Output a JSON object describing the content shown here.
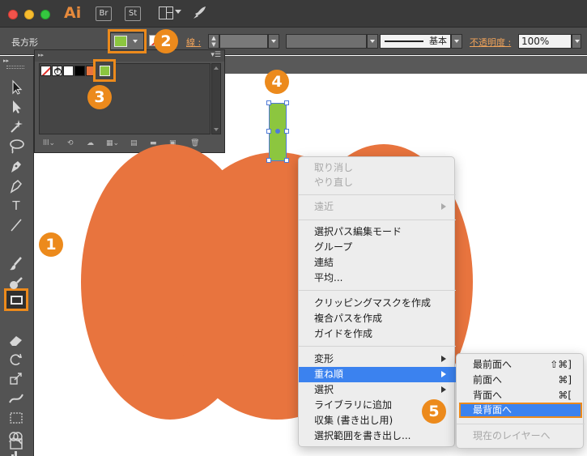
{
  "app": {
    "logo": "Ai",
    "bridge": "Br",
    "stock": "St"
  },
  "titlebar_icons": [
    "workspace-layout-icon",
    "rocket-icon"
  ],
  "control_bar": {
    "object_label": "長方形",
    "stroke_label": "線 :",
    "profile_label": "基本",
    "opacity_label": "不透明度 :",
    "opacity_value": "100%"
  },
  "colors": {
    "fill_green": "#8cc63f",
    "pumpkin_orange": "#e8743e",
    "highlight_orange": "#ec8a1c",
    "menu_highlight_blue": "#3b82ef"
  },
  "tools": [
    "selection-tool",
    "direct-selection-tool",
    "magic-wand-tool",
    "lasso-tool",
    "pen-tool",
    "curvature-tool",
    "type-tool",
    "line-segment-tool",
    "rectangle-tool",
    "paintbrush-tool",
    "blob-brush-tool",
    "eraser-tool",
    "rotate-tool",
    "scale-tool",
    "width-tool",
    "free-transform-tool",
    "shape-builder-tool",
    "graph-tool",
    "artboard-tool"
  ],
  "markers": [
    "1",
    "2",
    "3",
    "4",
    "5"
  ],
  "context_menu": {
    "undo": "取り消し",
    "redo": "やり直し",
    "recent": "遠近",
    "isolate": "選択パス編集モード",
    "group": "グループ",
    "join": "連結",
    "average": "平均...",
    "clipping": "クリッピングマスクを作成",
    "compound": "複合パスを作成",
    "guides": "ガイドを作成",
    "transform": "変形",
    "arrange": "重ね順",
    "select": "選択",
    "add_library": "ライブラリに追加",
    "collect": "収集 (書き出し用)",
    "export_selection": "選択範囲を書き出し..."
  },
  "arrange_submenu": {
    "bring_to_front": "最前面へ",
    "bring_to_front_shortcut": "⇧⌘]",
    "bring_forward": "前面へ",
    "bring_forward_shortcut": "⌘]",
    "send_backward": "背面へ",
    "send_backward_shortcut": "⌘[",
    "send_to_back": "最背面へ",
    "send_to_current_layer": "現在のレイヤーへ"
  }
}
